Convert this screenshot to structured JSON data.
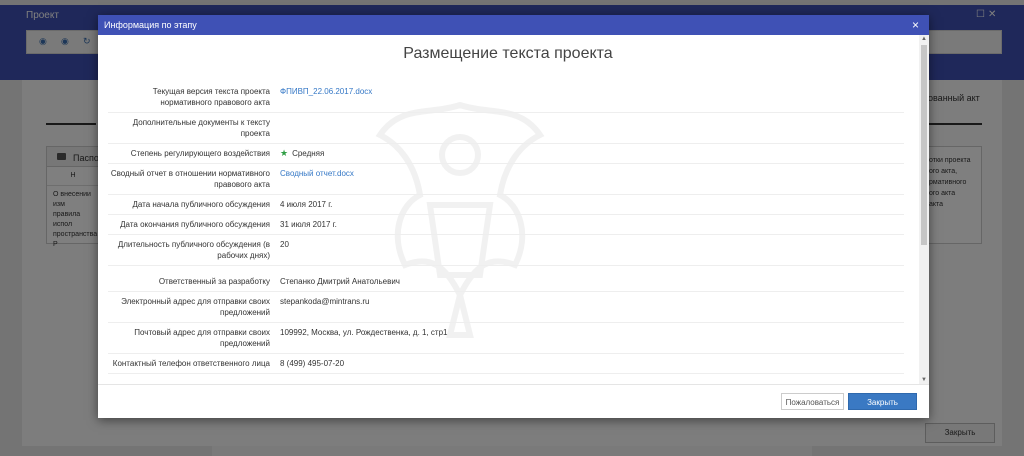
{
  "app": {
    "title": "Проект",
    "toolbar_icons": [
      "◉",
      "◉",
      "↻"
    ],
    "tab_right": "ованный акт",
    "panel_left": {
      "header": "Паспор",
      "sub": "Н",
      "text_lines": [
        "О внесении изм",
        "правила испол",
        "пространства Р"
      ]
    },
    "panel_right": {
      "text_lines": [
        "отки проекта",
        "ого акта,",
        "рмативного",
        "ого акта",
        "акта"
      ]
    },
    "close_label": "Закрыть"
  },
  "modal": {
    "header_title": "Информация по этапу",
    "close_glyph": "×",
    "stage_title": "Размещение текста проекта",
    "fields": [
      {
        "label": "Текущая версия текста проекта нормативного правового акта",
        "value": "ФПИВП_22.06.2017.docx",
        "type": "link"
      },
      {
        "label": "Дополнительные документы к тексту проекта",
        "value": "",
        "type": "text"
      },
      {
        "label": "Степень регулирующего воздействия",
        "value": "Средняя",
        "type": "star"
      },
      {
        "label": "Сводный отчет в отношении нормативного правового акта",
        "value": "Сводный отчет.docx",
        "type": "link"
      },
      {
        "label": "Дата начала публичного обсуждения",
        "value": "4 июля 2017 г.",
        "type": "text"
      },
      {
        "label": "Дата окончания публичного обсуждения",
        "value": "31 июля 2017 г.",
        "type": "text"
      },
      {
        "label": "Длительность публичного обсуждения (в рабочих днях)",
        "value": "20",
        "type": "text"
      },
      {
        "label": "Ответственный за разработку",
        "value": "Степанко Дмитрий Анатольевич",
        "type": "text"
      },
      {
        "label": "Электронный адрес для отправки своих предложений",
        "value": "stepankoda@mintrans.ru",
        "type": "text"
      },
      {
        "label": "Почтовый адрес для отправки своих предложений",
        "value": "109992, Москва, ул. Рождественка, д. 1, стр1",
        "type": "text"
      },
      {
        "label": "Контактный телефон ответственного лица",
        "value": "8 (499) 495-07-20",
        "type": "text"
      }
    ],
    "footer": {
      "complain_label": "Пожаловаться",
      "close_label": "Закрыть"
    }
  },
  "colors": {
    "header": "#3f51b5",
    "link": "#3578c6",
    "primary_button": "#3a79c3",
    "star": "#2f9e44"
  }
}
